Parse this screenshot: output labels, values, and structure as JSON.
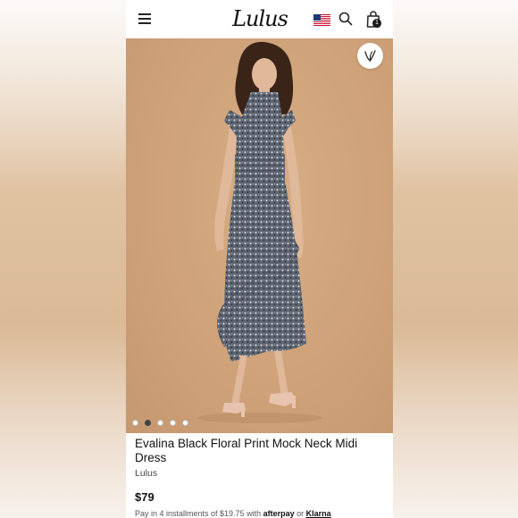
{
  "header": {
    "logo_text": "Lulus",
    "cart_count": "1"
  },
  "icons": {
    "menu": "hamburger-icon",
    "flag": "us-flag-icon",
    "search": "search-icon",
    "cart": "shopping-bag-icon",
    "wishlist": "wishlist-v-icon"
  },
  "gallery": {
    "dots": [
      {
        "active": false
      },
      {
        "active": true
      },
      {
        "active": false
      },
      {
        "active": false
      },
      {
        "active": false
      }
    ]
  },
  "product": {
    "title": "Evalina Black Floral Print Mock Neck Midi Dress",
    "brand": "Lulus",
    "price": "$79",
    "installment_prefix": "Pay in 4 installments of $19.75 with",
    "afterpay": "afterpay",
    "or": "or",
    "klarna": "Klarna"
  },
  "colors": {
    "backdrop": "#cfa279",
    "dress": "#5c6470",
    "skin": "#e0b89a",
    "sandal": "#e8c4b0",
    "text": "#111111"
  }
}
